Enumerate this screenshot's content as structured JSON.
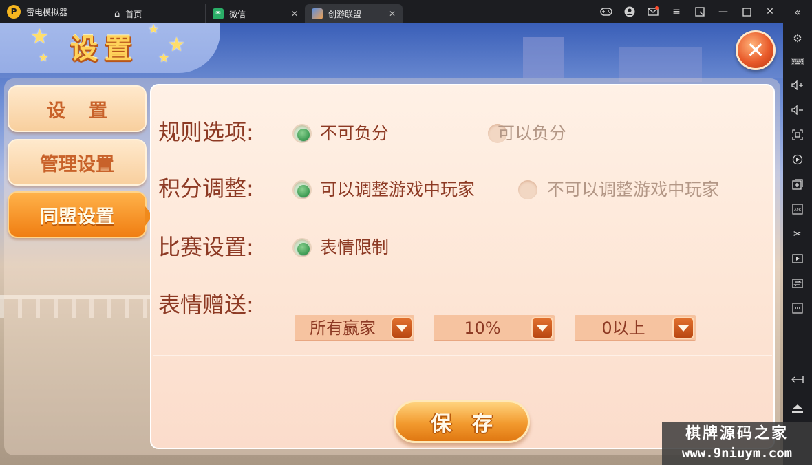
{
  "titlebar": {
    "app_name": "雷电模拟器",
    "logo_glyph": "P",
    "tabs": [
      {
        "label": "首页",
        "icon": "home-icon"
      },
      {
        "label": "微信",
        "icon": "wechat-icon"
      },
      {
        "label": "创游联盟",
        "icon": "game-icon",
        "active": true
      }
    ],
    "close_glyph": "✕",
    "tools": [
      "gamepad-icon",
      "user-icon",
      "mail-icon",
      "menu-icon",
      "resize-icon",
      "minimize-icon",
      "maximize-icon",
      "close-icon"
    ],
    "collapse_glyph": "«"
  },
  "sidebar": {
    "items": [
      "settings-icon",
      "keyboard-icon",
      "volume-up-icon",
      "volume-down-icon",
      "screenshot-icon",
      "sync-icon",
      "add-window-icon",
      "apk-icon",
      "scissors-icon",
      "video-icon",
      "swap-icon",
      "more-icon",
      "back-icon",
      "home-icon"
    ]
  },
  "game": {
    "header_title": "设置",
    "close_glyph": "✕",
    "menu": [
      {
        "label": "设置"
      },
      {
        "label": "管理设置"
      },
      {
        "label": "同盟设置",
        "active": true
      }
    ],
    "rows": {
      "rule": {
        "label": "规则选项:",
        "options": [
          {
            "label": "不可负分",
            "selected": true
          },
          {
            "label": "可以负分",
            "selected": false
          }
        ]
      },
      "score": {
        "label": "积分调整:",
        "options": [
          {
            "label": "可以调整游戏中玩家",
            "selected": true
          },
          {
            "label": "不可以调整游戏中玩家",
            "selected": false
          }
        ]
      },
      "match": {
        "label": "比赛设置:",
        "options": [
          {
            "label": "表情限制",
            "selected": true
          }
        ]
      },
      "emoji_gift": {
        "label": "表情赠送:",
        "dropdowns": [
          {
            "value": "所有赢家"
          },
          {
            "value": "10%"
          },
          {
            "value": "0以上"
          }
        ]
      }
    },
    "save_label": "保存"
  },
  "watermark": {
    "line1": "棋牌源码之家",
    "line2": "www.9niuym.com"
  },
  "colors": {
    "accent_orange": "#f07e12",
    "text_brown": "#8d3a24",
    "radio_green": "#3c9a52"
  }
}
